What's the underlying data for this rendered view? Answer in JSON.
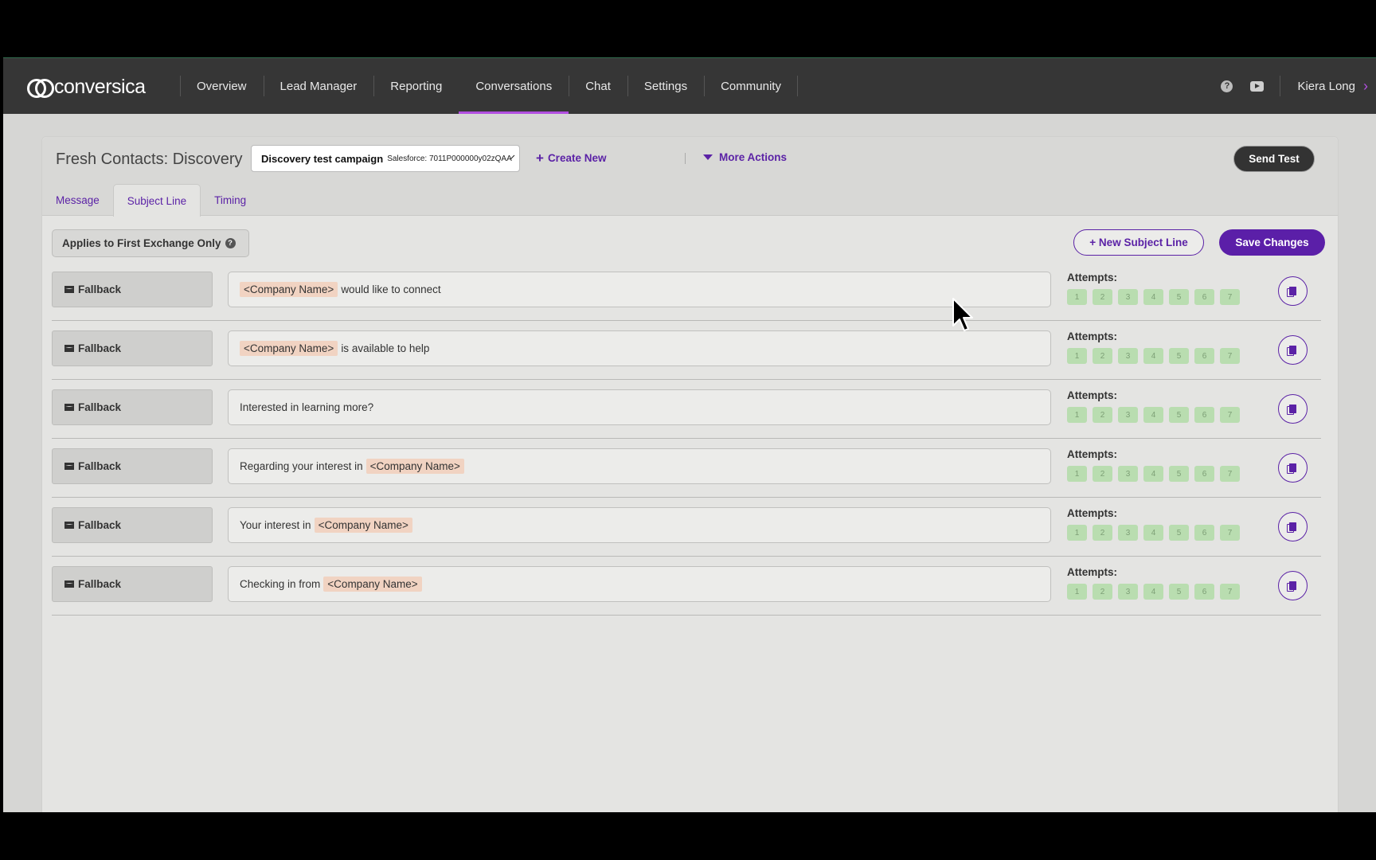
{
  "app": {
    "logo_text": "conversica",
    "nav": [
      {
        "label": "Overview"
      },
      {
        "label": "Lead Manager"
      },
      {
        "label": "Reporting"
      },
      {
        "label": "Conversations",
        "active": true
      },
      {
        "label": "Chat"
      },
      {
        "label": "Settings"
      },
      {
        "label": "Community"
      }
    ],
    "user_name": "Kiera Long"
  },
  "header": {
    "title": "Fresh Contacts: Discovery",
    "campaign_name": "Discovery test campaign",
    "campaign_source": "Salesforce: 7011P000000y02zQAA",
    "create_new": "Create New",
    "more_actions": "More Actions",
    "send_test": "Send Test"
  },
  "tabs": [
    {
      "label": "Message"
    },
    {
      "label": "Subject Line",
      "active": true
    },
    {
      "label": "Timing"
    }
  ],
  "toolbar": {
    "applies_label": "Applies to First Exchange Only",
    "new_subject_label": "+ New Subject Line",
    "save_label": "Save Changes"
  },
  "attempts_label": "Attempts:",
  "attempt_numbers": [
    "1",
    "2",
    "3",
    "4",
    "5",
    "6",
    "7"
  ],
  "subject_lines": [
    {
      "type": "Fallback",
      "parts": [
        {
          "token": "<Company Name>"
        },
        {
          "text": "would like to connect"
        }
      ]
    },
    {
      "type": "Fallback",
      "parts": [
        {
          "token": "<Company Name>"
        },
        {
          "text": "is available to help"
        }
      ]
    },
    {
      "type": "Fallback",
      "parts": [
        {
          "text": "Interested in learning more?"
        }
      ]
    },
    {
      "type": "Fallback",
      "parts": [
        {
          "text": "Regarding your interest in"
        },
        {
          "token": "<Company Name>"
        }
      ]
    },
    {
      "type": "Fallback",
      "parts": [
        {
          "text": "Your interest in"
        },
        {
          "token": "<Company Name>"
        }
      ]
    },
    {
      "type": "Fallback",
      "parts": [
        {
          "text": "Checking in from"
        },
        {
          "token": "<Company Name>"
        }
      ]
    }
  ],
  "colors": {
    "accent": "#5b22a6",
    "nav_active": "#b24fe0",
    "token_bg": "#f1d3c2",
    "chip_bg": "#b9ddb0"
  }
}
